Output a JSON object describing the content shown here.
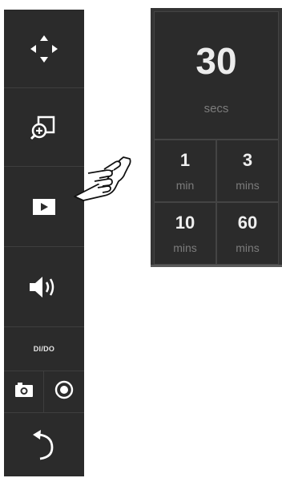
{
  "toolbar": {
    "dido_label": "DI/DO",
    "icons": {
      "pan": "pan-arrows-icon",
      "zoom": "zoom-in-icon",
      "play": "play-icon",
      "audio": "speaker-icon",
      "snapshot": "camera-icon",
      "record": "record-icon",
      "back": "undo-arrow-icon"
    }
  },
  "cursor_icon": "pointing-hand-icon",
  "duration_panel": {
    "selected": {
      "value": "30",
      "unit": "secs"
    },
    "options": [
      {
        "value": "1",
        "unit": "min"
      },
      {
        "value": "3",
        "unit": "mins"
      },
      {
        "value": "10",
        "unit": "mins"
      },
      {
        "value": "60",
        "unit": "mins"
      }
    ]
  },
  "colors": {
    "toolbar_bg": "#2b2b2b",
    "panel_bg": "#343434",
    "text": "#ececec",
    "muted": "#7c7c7c"
  }
}
